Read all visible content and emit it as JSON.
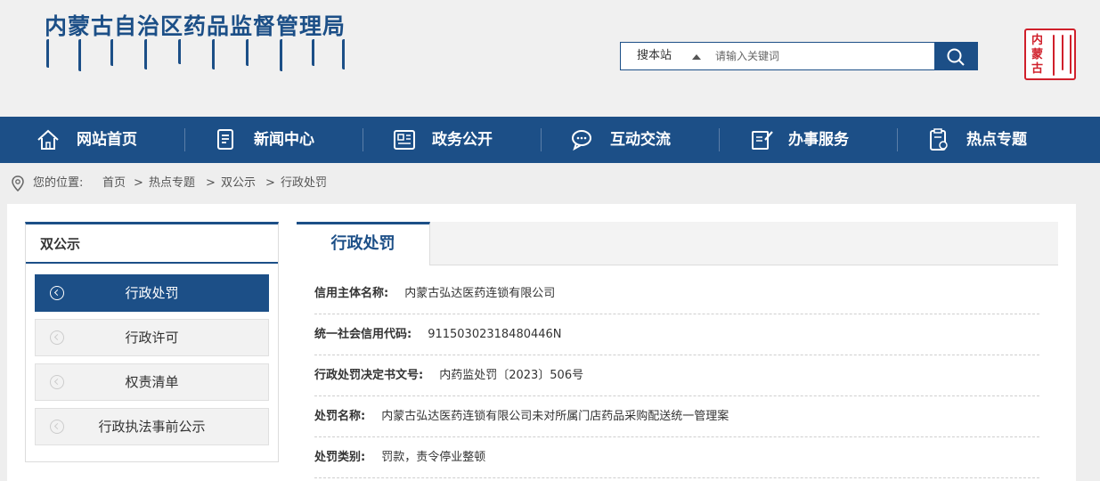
{
  "header": {
    "site_title": "内蒙古自治区药品监督管理局",
    "search_scope": "搜本站",
    "search_placeholder": "请输入关键词",
    "seal_text": "内蒙古"
  },
  "nav": {
    "items": [
      {
        "label": "网站首页",
        "icon": "home-icon"
      },
      {
        "label": "新闻中心",
        "icon": "document-icon"
      },
      {
        "label": "政务公开",
        "icon": "newspaper-icon"
      },
      {
        "label": "互动交流",
        "icon": "chat-icon"
      },
      {
        "label": "办事服务",
        "icon": "edit-icon"
      },
      {
        "label": "热点专题",
        "icon": "clipboard-icon"
      }
    ]
  },
  "breadcrumb": {
    "prefix": "您的位置:",
    "items": [
      "首页",
      "热点专题",
      "双公示",
      "行政处罚"
    ],
    "separator": ">"
  },
  "sidebar": {
    "title": "双公示",
    "items": [
      {
        "label": "行政处罚",
        "active": true
      },
      {
        "label": "行政许可",
        "active": false
      },
      {
        "label": "权责清单",
        "active": false
      },
      {
        "label": "行政执法事前公示",
        "active": false
      }
    ]
  },
  "content": {
    "tab": "行政处罚",
    "fields": [
      {
        "key": "信用主体名称:",
        "value": "内蒙古弘达医药连锁有限公司"
      },
      {
        "key": "统一社会信用代码:",
        "value": "91150302318480446N"
      },
      {
        "key": "行政处罚决定书文号:",
        "value": "内药监处罚〔2023〕506号"
      },
      {
        "key": "处罚名称:",
        "value": "内蒙古弘达医药连锁有限公司未对所属门店药品采购配送统一管理案"
      },
      {
        "key": "处罚类别:",
        "value": "罚款，责令停业整顿"
      }
    ]
  },
  "colors": {
    "brand": "#1c4f87",
    "seal": "#d0202b",
    "background": "#eeeeee"
  }
}
